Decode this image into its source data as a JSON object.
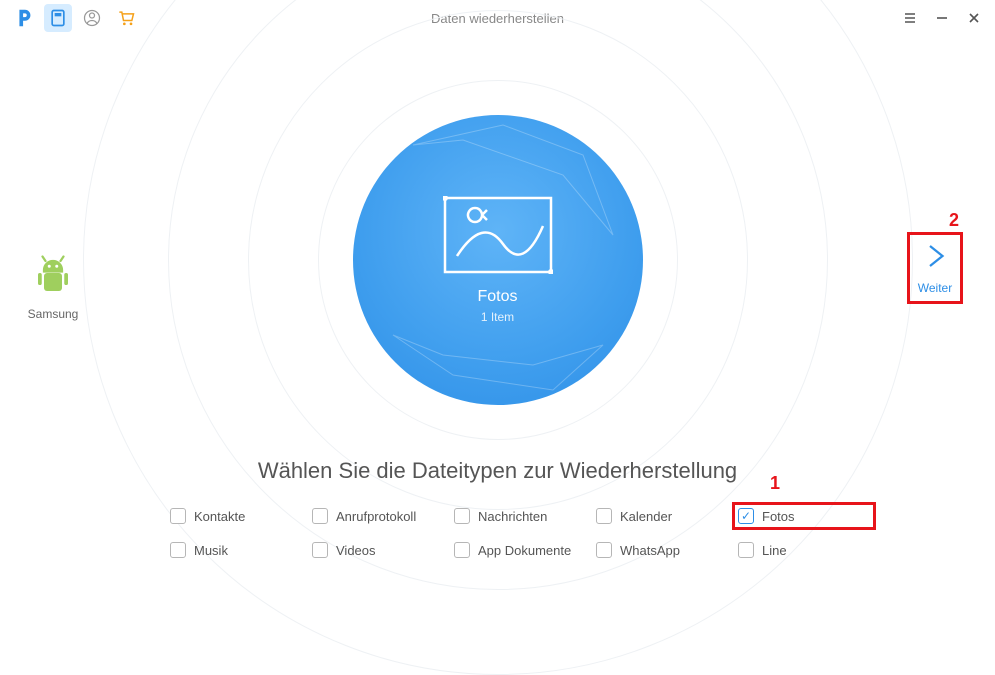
{
  "header": {
    "title": "Daten wiederherstellen"
  },
  "device": {
    "name": "Samsung"
  },
  "stage": {
    "category": "Fotos",
    "subtitle": "1 Item"
  },
  "next": {
    "label": "Weiter",
    "callout": "2"
  },
  "headline": "Wählen Sie die Dateitypen zur Wiederherstellung",
  "options_callout": "1",
  "options": [
    {
      "label": "Kontakte",
      "checked": false
    },
    {
      "label": "Anrufprotokoll",
      "checked": false
    },
    {
      "label": "Nachrichten",
      "checked": false
    },
    {
      "label": "Kalender",
      "checked": false
    },
    {
      "label": "Fotos",
      "checked": true,
      "highlight": true
    },
    {
      "label": "Musik",
      "checked": false
    },
    {
      "label": "Videos",
      "checked": false
    },
    {
      "label": "App Dokumente",
      "checked": false
    },
    {
      "label": "WhatsApp",
      "checked": false
    },
    {
      "label": "Line",
      "checked": false
    }
  ]
}
